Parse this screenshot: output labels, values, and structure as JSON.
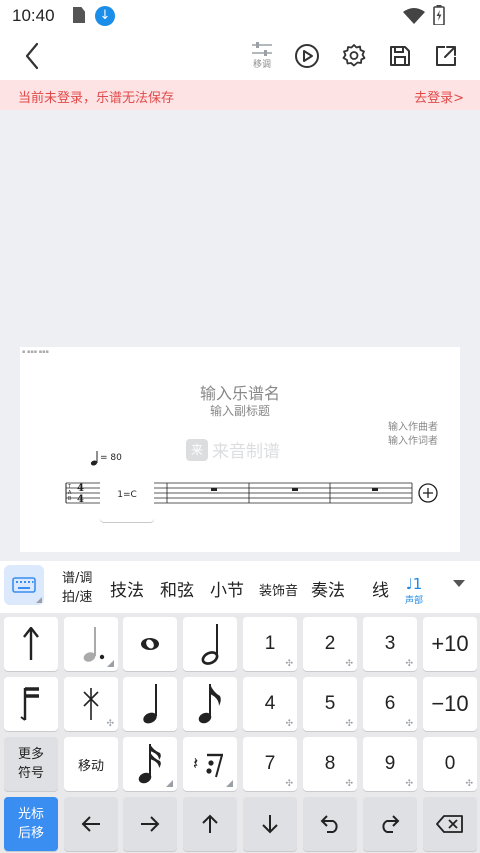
{
  "status_bar": {
    "time": "10:40"
  },
  "toolbar": {
    "transpose_label": "移调"
  },
  "banner": {
    "message": "当前未登录，乐谱无法保存",
    "login_link": "去登录>"
  },
  "score": {
    "title_placeholder": "输入乐谱名",
    "subtitle_placeholder": "输入副标题",
    "composer_placeholder": "输入作曲者",
    "lyricist_placeholder": "输入作词者",
    "watermark": "来音制谱",
    "watermark_icon": "来",
    "tempo": "= 80",
    "key": "1=C",
    "time_signature": [
      "4",
      "4"
    ]
  },
  "tabs": [
    {
      "name": "tab-notation-tempo",
      "label": "谱/调\n拍/速"
    },
    {
      "name": "tab-technique",
      "label": "技法"
    },
    {
      "name": "tab-chord",
      "label": "和弦"
    },
    {
      "name": "tab-measure",
      "label": "小节"
    },
    {
      "name": "tab-ornament",
      "label": "装饰音"
    },
    {
      "name": "tab-articulation",
      "label": "奏法"
    },
    {
      "name": "tab-line",
      "label": "线"
    }
  ],
  "voice": {
    "number": "1",
    "label": "声部"
  },
  "keys": {
    "num1": "1",
    "num2": "2",
    "num3": "3",
    "num4": "4",
    "num5": "5",
    "num6": "6",
    "num7": "7",
    "num8": "8",
    "num9": "9",
    "num0": "0",
    "plus10": "+10",
    "minus10": "−10",
    "more_symbols": "更多\n符号",
    "move": "移动",
    "cursor_back": "光标\n后移"
  },
  "colors": {
    "accent": "#3a8ef2",
    "banner_bg": "#fde3e4",
    "banner_text": "#e24a4a"
  }
}
